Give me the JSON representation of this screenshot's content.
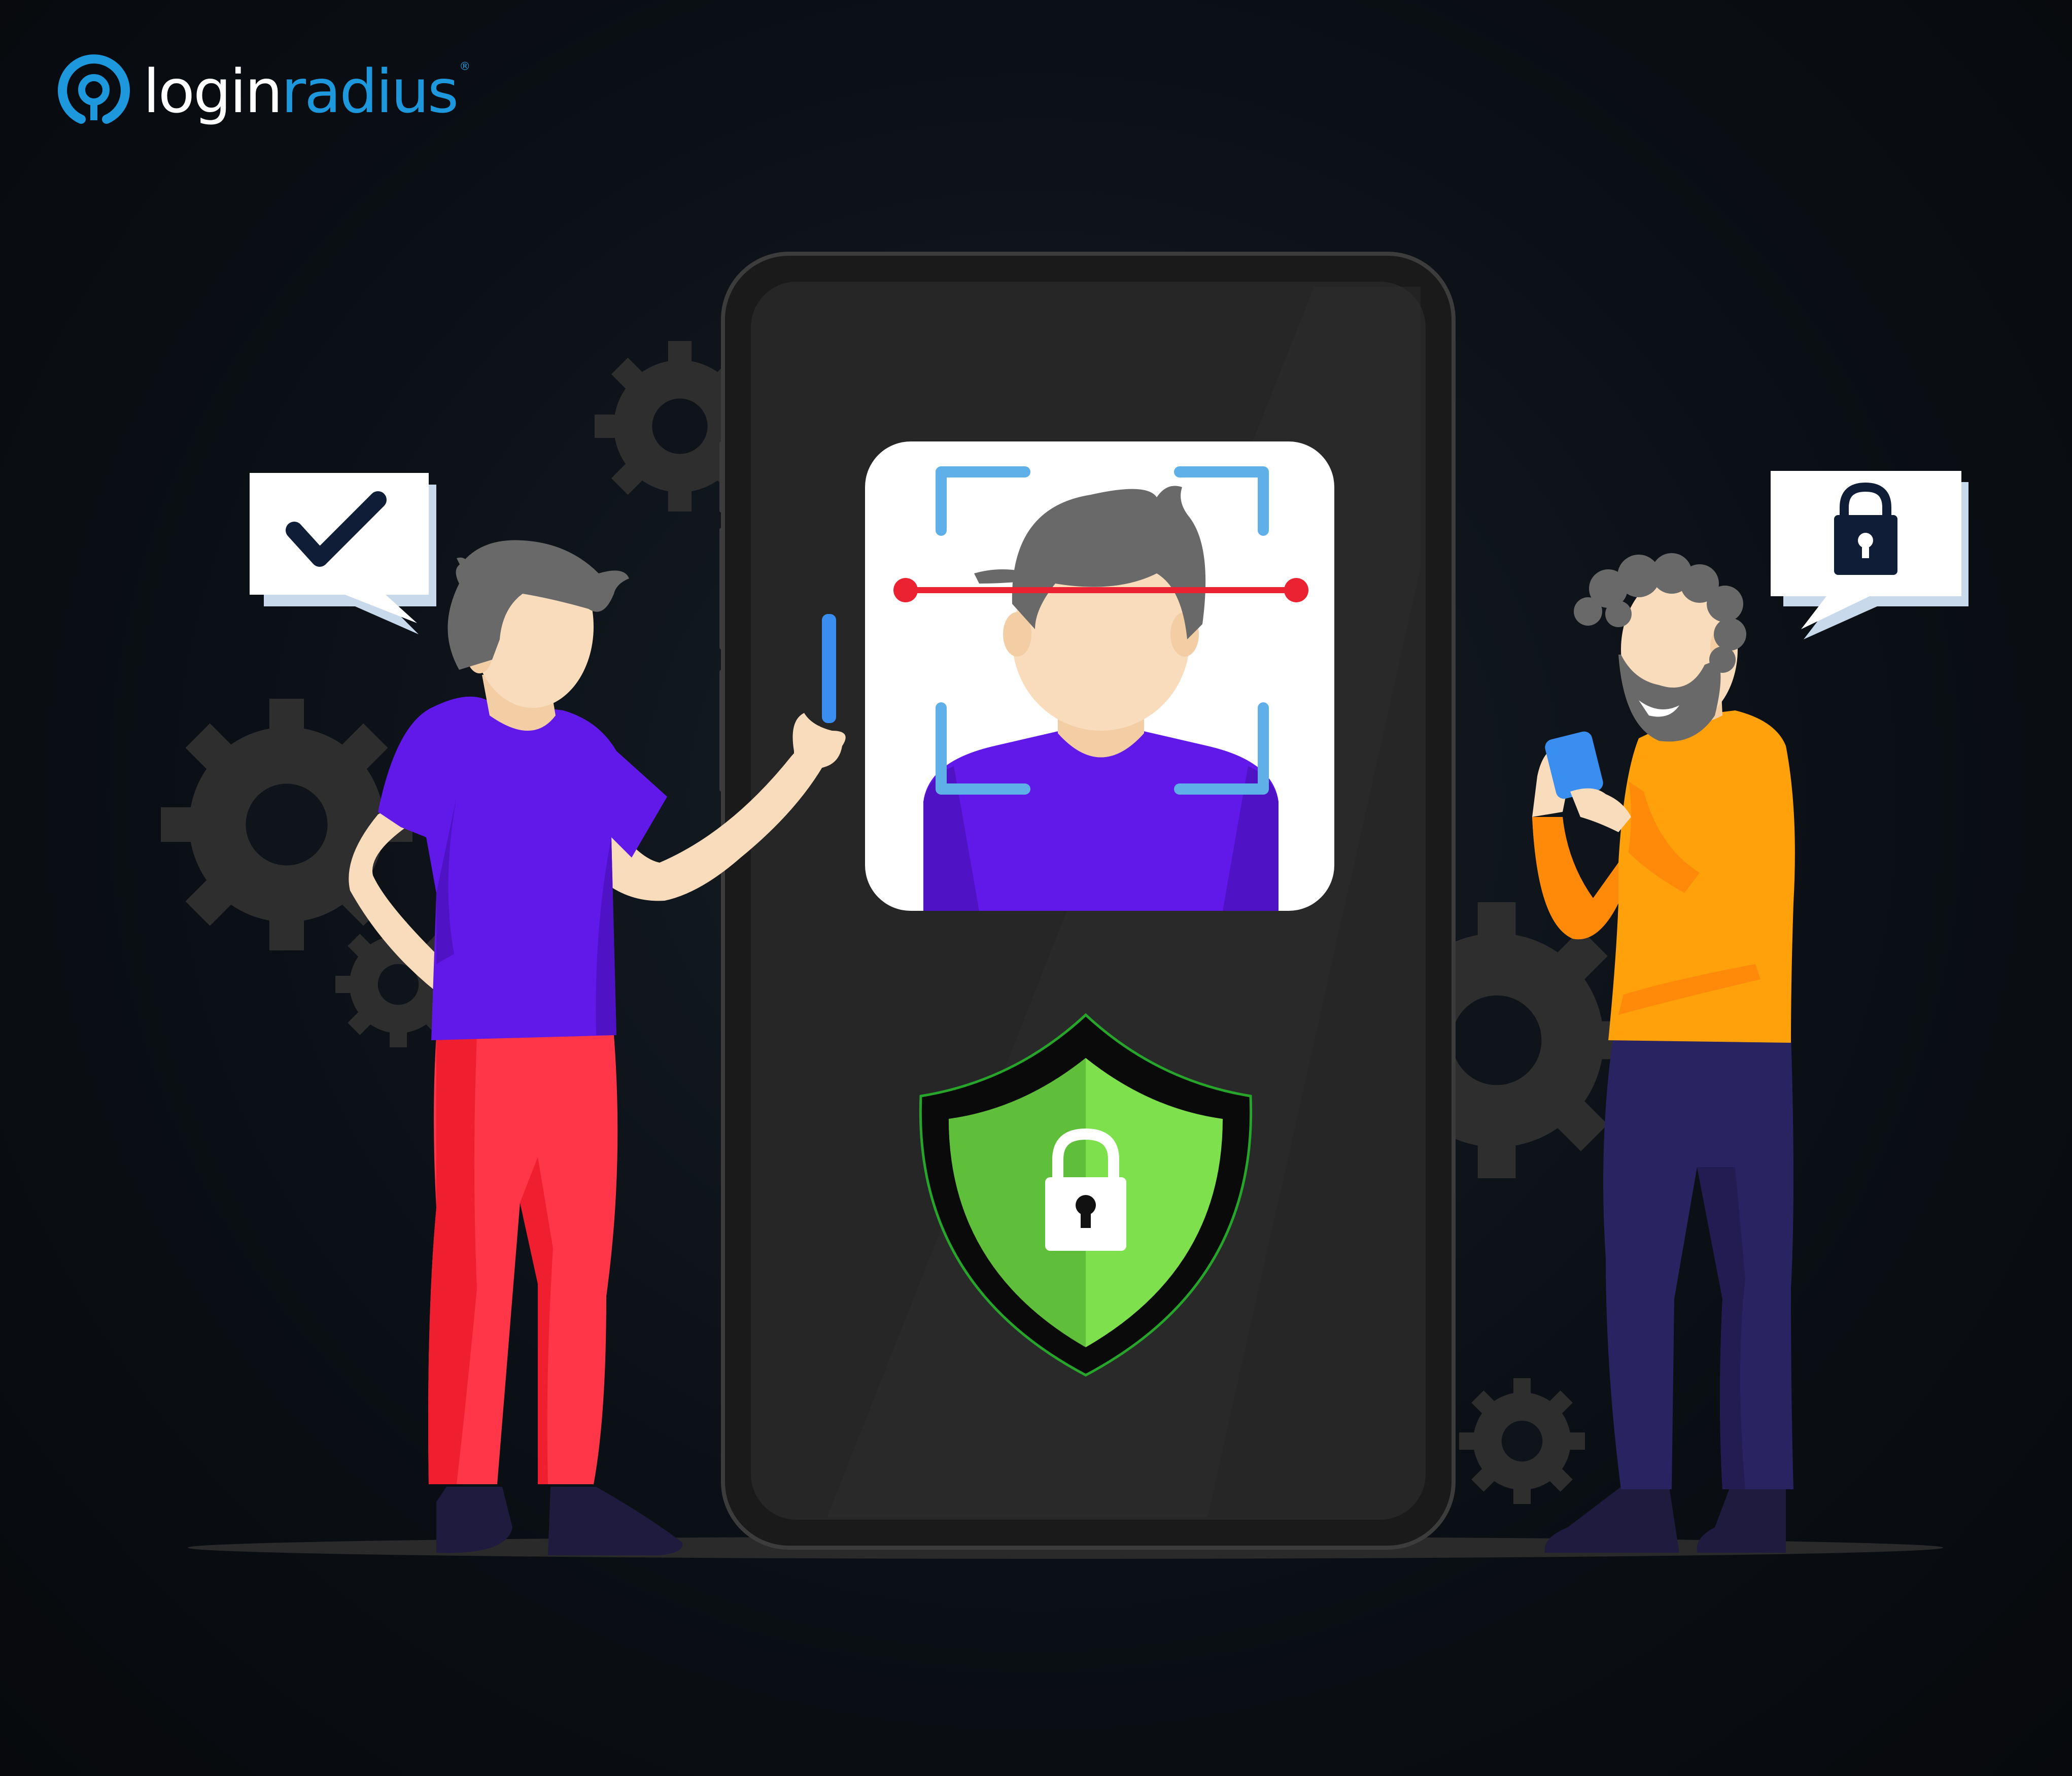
{
  "brand": {
    "name_part_1": "login",
    "name_part_2": "radius",
    "registered_mark": "®"
  },
  "colors": {
    "background": "#0b1016",
    "brand_blue": "#1e98dc",
    "phone_body": "#232323",
    "scan_bracket": "#5fb0e9",
    "scan_line": "#ea2232",
    "shield_green": "#7fe04e",
    "left_shirt": "#6119ea",
    "left_pants": "#ff3647",
    "right_sweater": "#ffa10a",
    "right_pants": "#2a2361"
  },
  "icons": [
    "loginradius-logo-icon",
    "checkmark-icon",
    "padlock-icon",
    "face-scan-icon",
    "security-shield-icon",
    "gear-icon"
  ]
}
